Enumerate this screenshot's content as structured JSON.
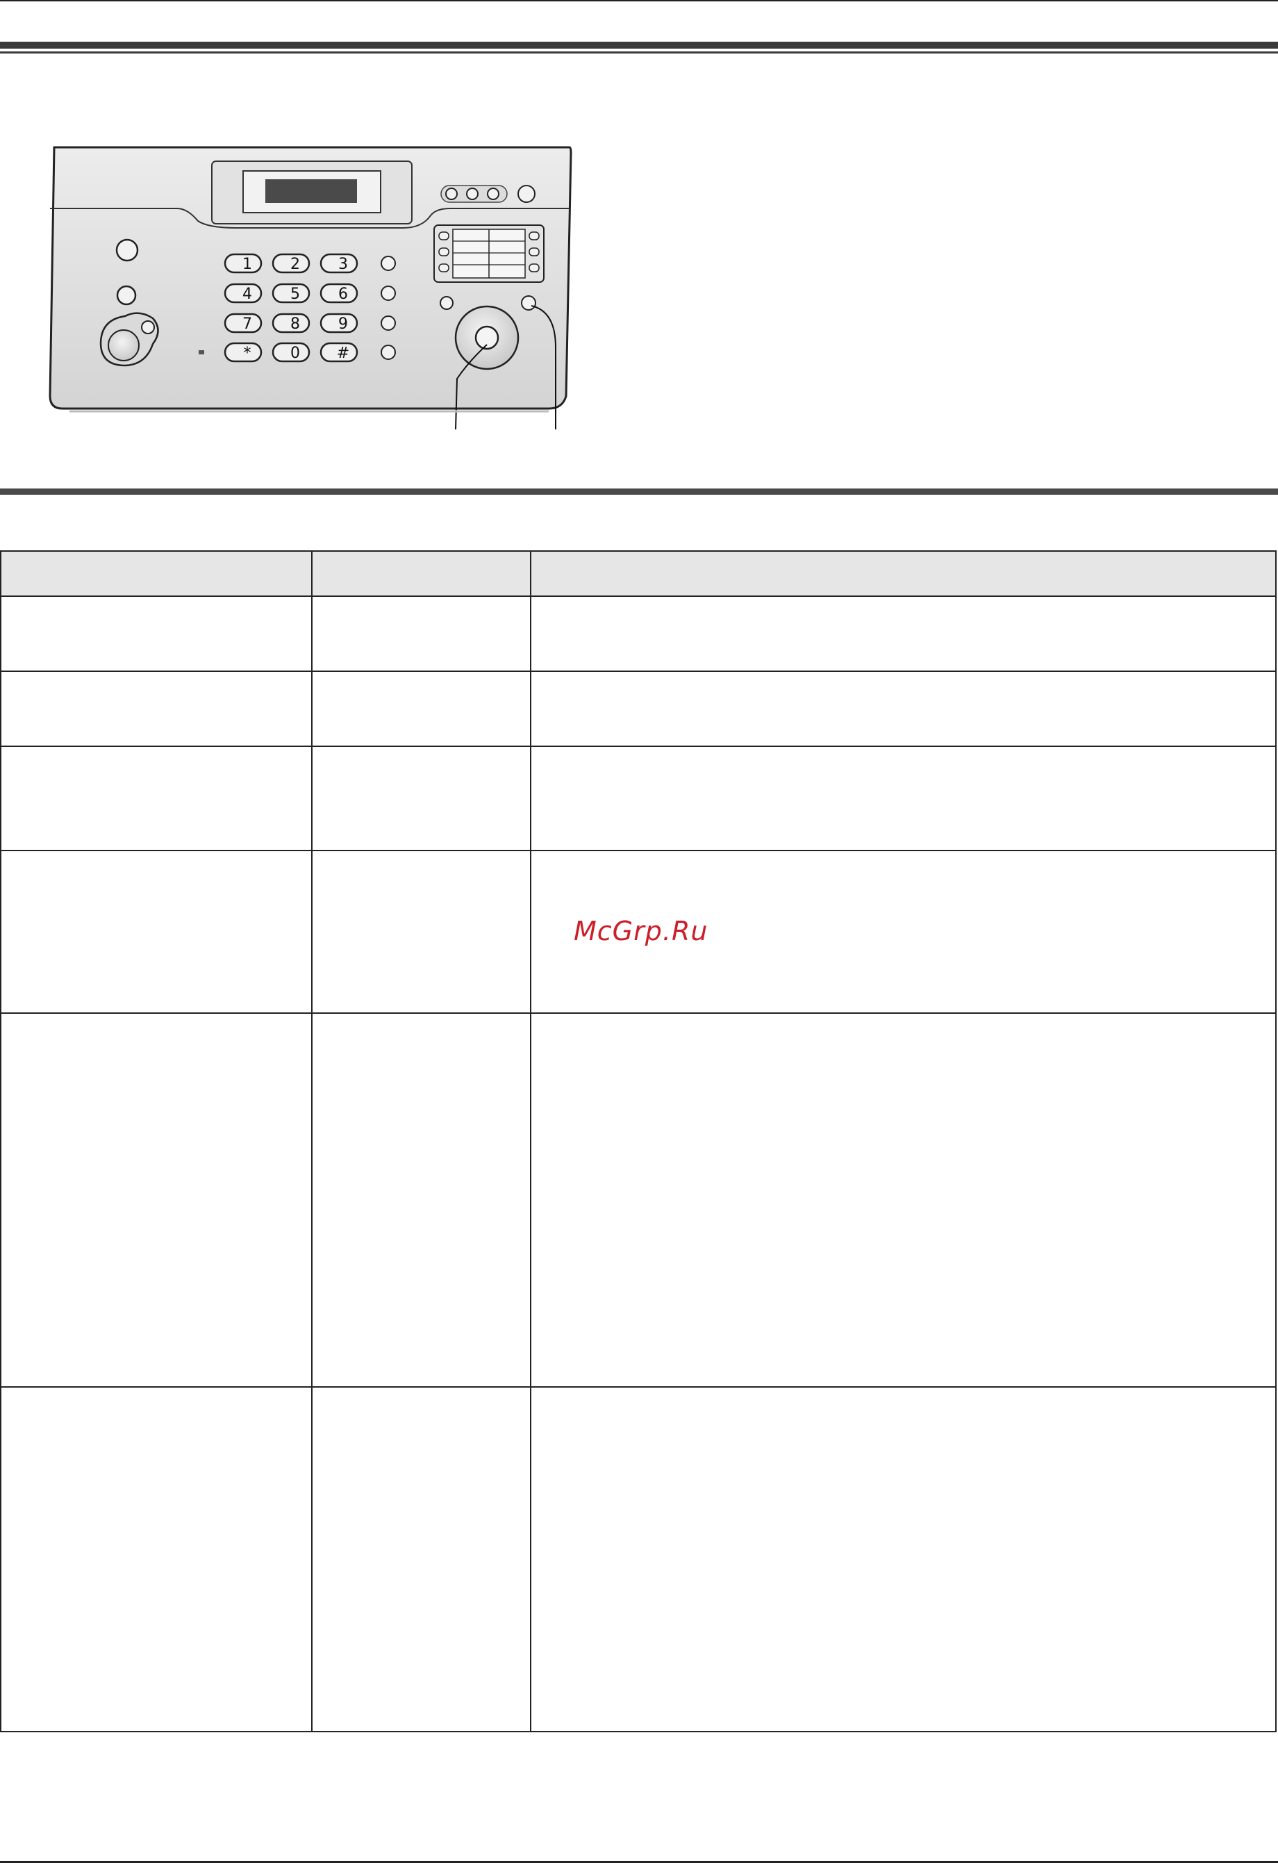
{
  "watermark": "McGrp.Ru",
  "device": {
    "keypad": [
      "1",
      "2",
      "3",
      "4",
      "5",
      "6",
      "7",
      "8",
      "9",
      "*",
      "0",
      "#"
    ]
  },
  "table": {
    "columns": [
      "",
      "",
      ""
    ],
    "rows": [
      [
        "",
        "",
        ""
      ],
      [
        "",
        "",
        ""
      ],
      [
        "",
        "",
        ""
      ],
      [
        "",
        "",
        ""
      ],
      [
        "",
        "",
        ""
      ],
      [
        "",
        "",
        ""
      ]
    ]
  },
  "colors": {
    "watermark": "#cc1f2a",
    "header_fill": "#e6e6e6",
    "rule": "#3a3a3a"
  }
}
